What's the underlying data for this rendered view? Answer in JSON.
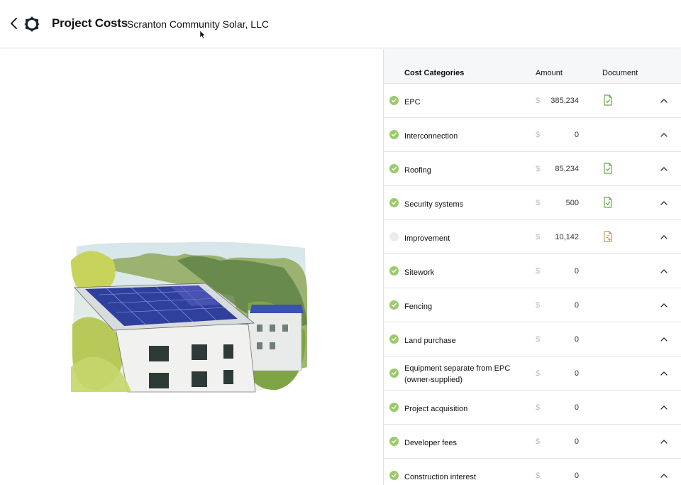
{
  "header": {
    "title": "Project Costs",
    "subtitle": "Scranton Community Solar, LLC"
  },
  "table": {
    "col_category": "Cost Categories",
    "col_amount": "Amount",
    "col_document": "Document",
    "currency_symbol": "$",
    "rows": [
      {
        "label": "EPC",
        "amount": "385,234",
        "complete": true,
        "document": "doc-check-icon"
      },
      {
        "label": "Interconnection",
        "amount": "0",
        "complete": true,
        "document": null
      },
      {
        "label": "Roofing",
        "amount": "85,234",
        "complete": true,
        "document": "doc-check-icon"
      },
      {
        "label": "Security systems",
        "amount": "500",
        "complete": true,
        "document": "doc-check-icon"
      },
      {
        "label": "Improvement",
        "amount": "10,142",
        "complete": false,
        "document": "doc-add-icon"
      },
      {
        "label": "Sitework",
        "amount": "0",
        "complete": true,
        "document": null
      },
      {
        "label": "Fencing",
        "amount": "0",
        "complete": true,
        "document": null
      },
      {
        "label": "Land purchase",
        "amount": "0",
        "complete": true,
        "document": null
      },
      {
        "label": "Equipment separate from EPC (owner-supplied)",
        "amount": "0",
        "complete": true,
        "document": null
      },
      {
        "label": "Project acquisition",
        "amount": "0",
        "complete": true,
        "document": null
      },
      {
        "label": "Developer fees",
        "amount": "0",
        "complete": true,
        "document": null
      },
      {
        "label": "Construction interest",
        "amount": "0",
        "complete": true,
        "document": null
      }
    ]
  },
  "colors": {
    "check_green": "#9acb6a",
    "doc_green": "#6aa84f",
    "doc_tan": "#b59a6a"
  }
}
